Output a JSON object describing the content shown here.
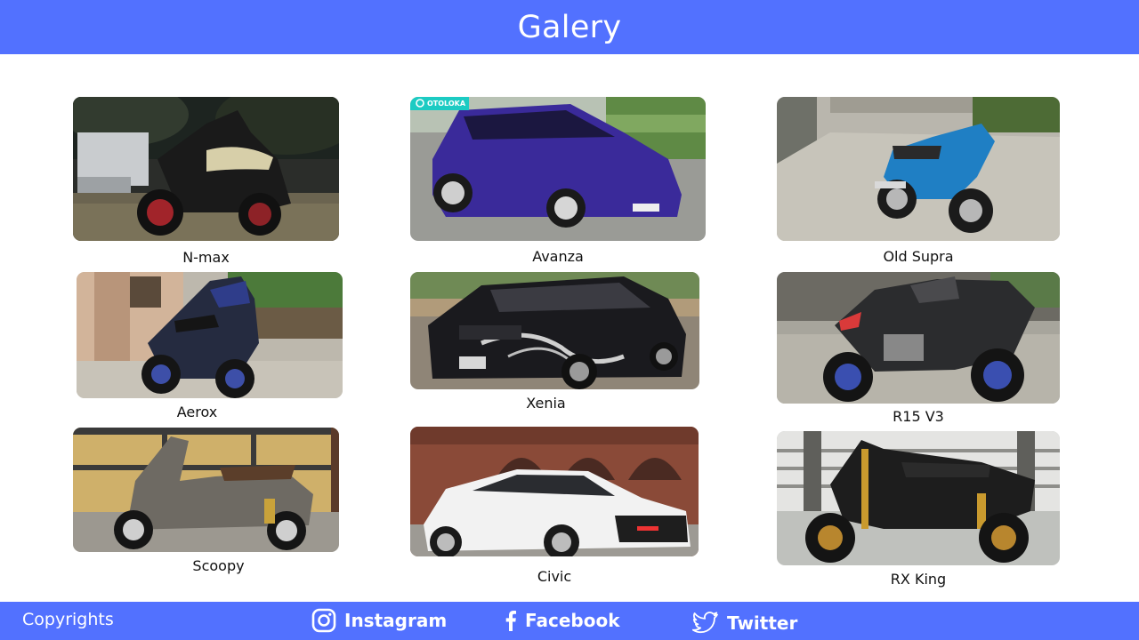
{
  "header": {
    "title": "Galery"
  },
  "gallery": {
    "items": [
      {
        "caption": "N-max"
      },
      {
        "caption": "Avanza",
        "watermark": "OTOLOKA"
      },
      {
        "caption": "Old Supra"
      },
      {
        "caption": "Aerox"
      },
      {
        "caption": "Xenia"
      },
      {
        "caption": "R15 V3"
      },
      {
        "caption": "Scoopy"
      },
      {
        "caption": "Civic"
      },
      {
        "caption": "RX King"
      }
    ]
  },
  "footer": {
    "copyright": "Copyrights",
    "links": [
      {
        "label": "Instagram",
        "icon": "instagram-icon"
      },
      {
        "label": "Facebook",
        "icon": "facebook-icon"
      },
      {
        "label": "Twitter",
        "icon": "twitter-icon"
      }
    ]
  },
  "colors": {
    "accent": "#5271ff",
    "text": "#111111",
    "background": "#ffffff"
  }
}
